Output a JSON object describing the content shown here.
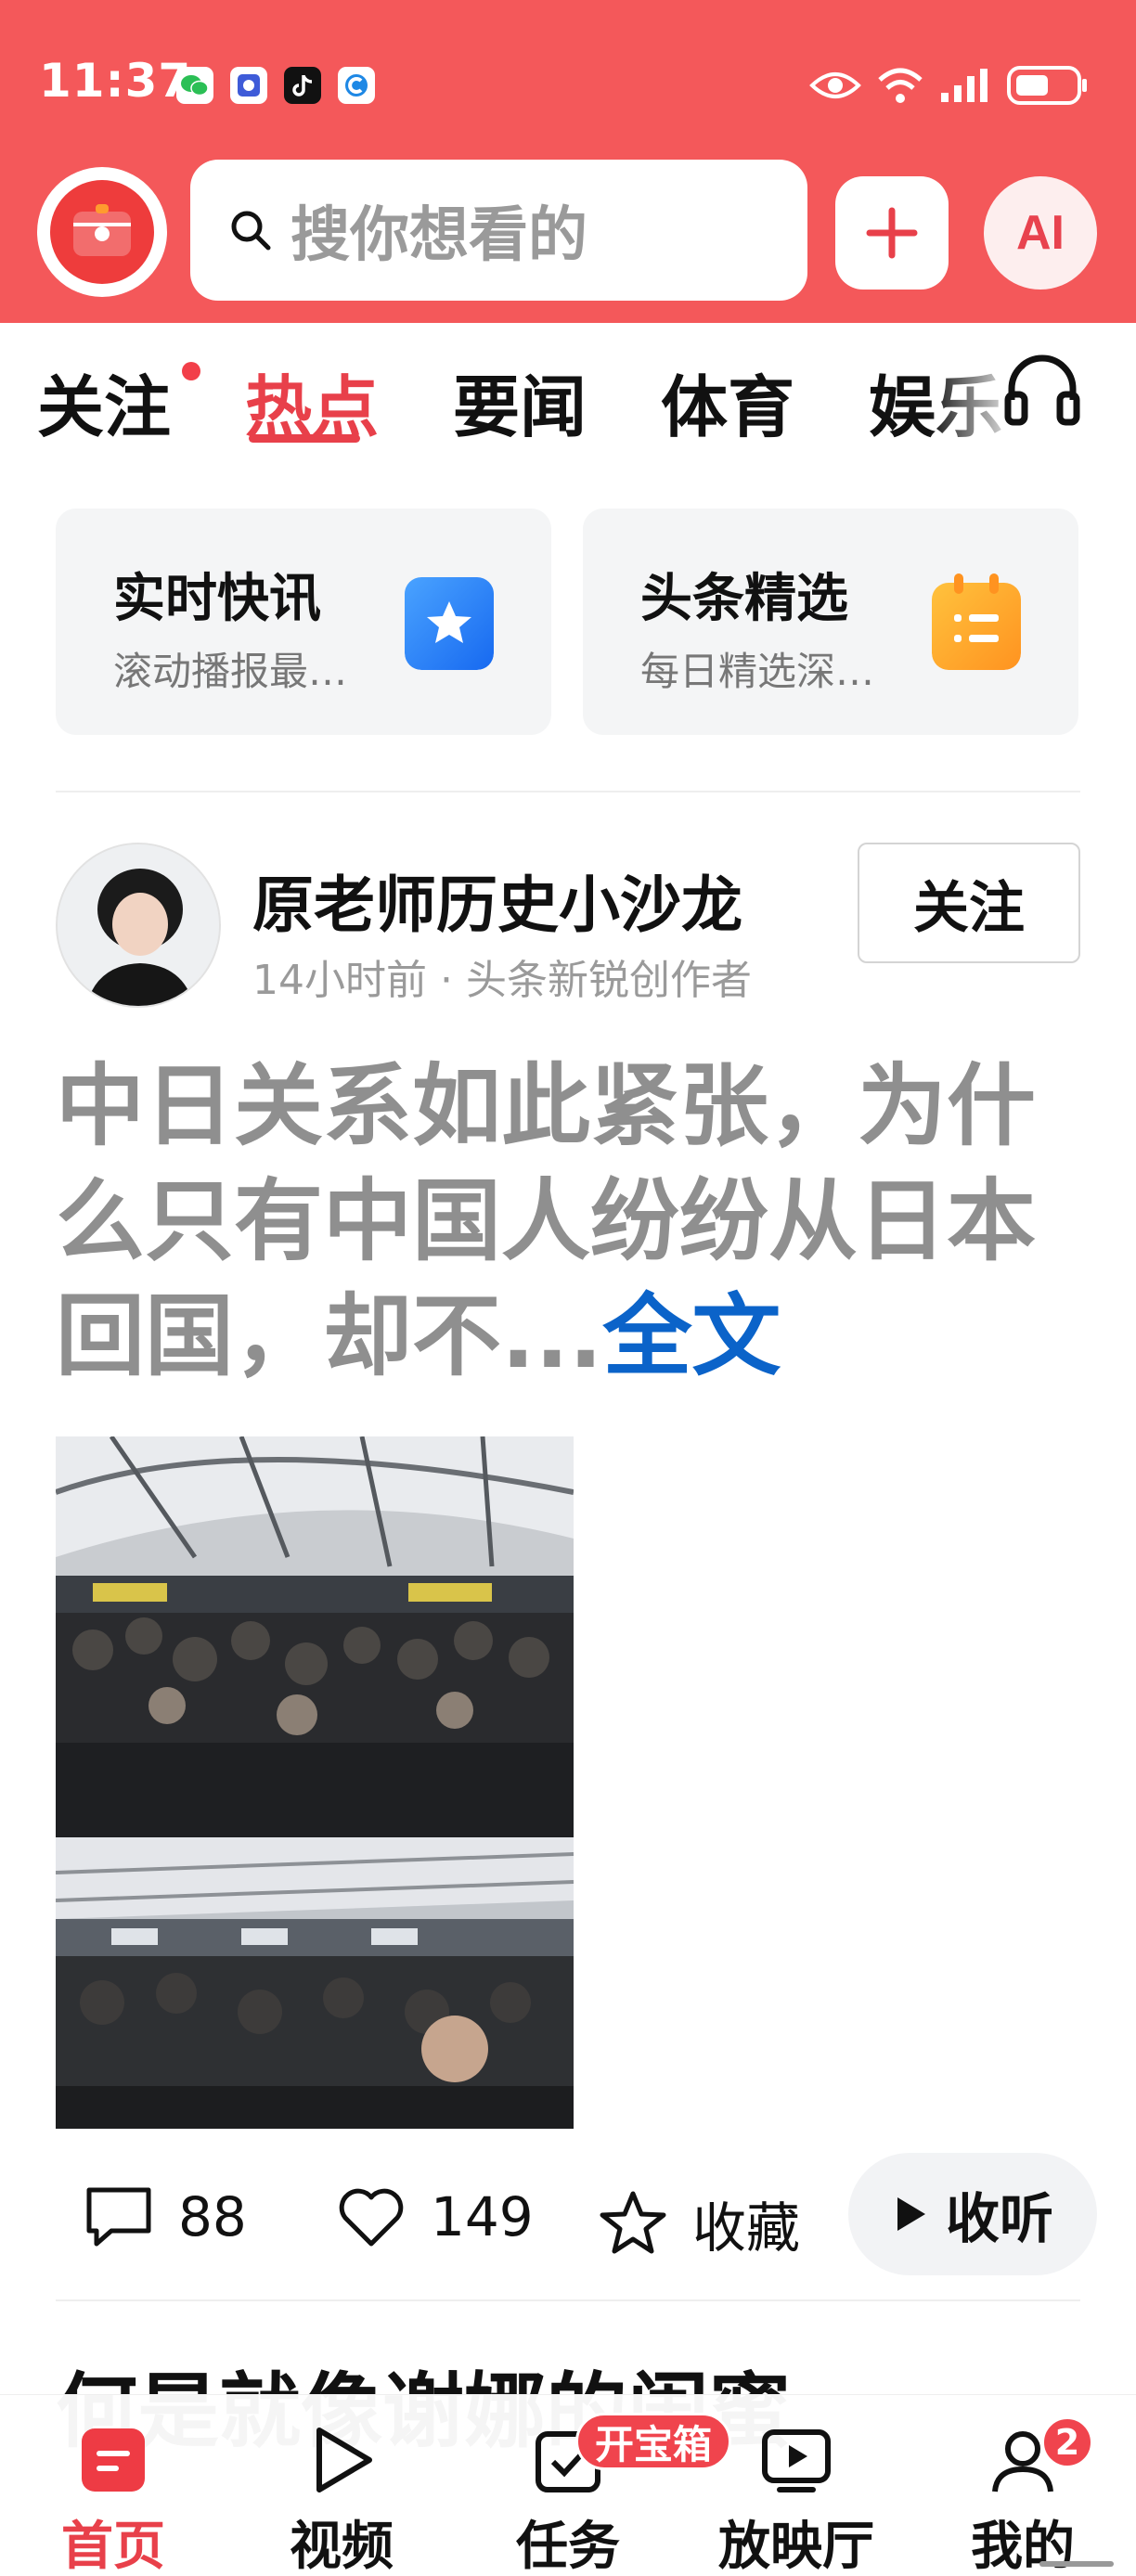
{
  "status_bar": {
    "time": "11:37",
    "app_icons": [
      "wechat-icon",
      "app-icon",
      "tiktok-icon",
      "app-c-icon"
    ],
    "right_icons": [
      "eye-icon",
      "wifi-icon",
      "signal-icon",
      "battery-icon"
    ]
  },
  "header": {
    "search_placeholder": "搜你想看的",
    "ai_label": "AI",
    "accent_color": "#f4585a"
  },
  "tabs": {
    "items": [
      {
        "label": "关注",
        "has_dot": true
      },
      {
        "label": "热点",
        "active": true
      },
      {
        "label": "要闻"
      },
      {
        "label": "体育"
      },
      {
        "label": "娱乐"
      }
    ]
  },
  "feature_cards": [
    {
      "title": "实时快讯",
      "subtitle": "滚动播报最…",
      "icon": "star-icon"
    },
    {
      "title": "头条精选",
      "subtitle": "每日精选深…",
      "icon": "calendar-list-icon"
    }
  ],
  "post": {
    "author": "原老师历史小沙龙",
    "meta": "14小时前 · 头条新锐创作者",
    "follow_label": "关注",
    "headline": "中日关系如此紧张，为什么只有中国人纷纷从日本回国，却不...",
    "full_text_link": "全文",
    "comments": "88",
    "likes": "149",
    "favorite_label": "收藏",
    "listen_label": "收听"
  },
  "next_post_title": "何是就像谢娜的闺蜜",
  "bottom_nav": {
    "items": [
      {
        "label": "首页",
        "active": true,
        "icon": "home-icon"
      },
      {
        "label": "视频",
        "icon": "play-icon"
      },
      {
        "label": "任务",
        "icon": "task-icon"
      },
      {
        "label": "放映厅",
        "icon": "cinema-icon"
      },
      {
        "label": "我的",
        "icon": "user-icon"
      }
    ],
    "task_badge": "开宝箱",
    "profile_badge": "2"
  }
}
